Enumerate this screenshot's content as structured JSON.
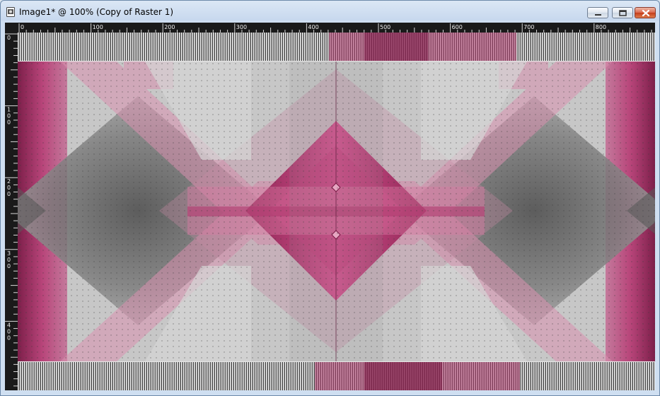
{
  "window": {
    "title": "Image1* @ 100% (Copy of Raster 1)",
    "icon": "image-document-icon",
    "controls": {
      "minimize": "minimize-icon",
      "maximize": "maximize-icon",
      "close": "close-icon"
    }
  },
  "ruler_h": {
    "labels": [
      "0",
      "100",
      "200",
      "300",
      "400",
      "500",
      "600",
      "700",
      "800"
    ]
  },
  "ruler_v": {
    "labels": [
      "0",
      "100",
      "200",
      "300",
      "400"
    ]
  },
  "colors": {
    "magenta": "#b0306a",
    "pink": "#d88aa8",
    "gray_light": "#c6c6c6",
    "gray_dark": "#555555",
    "ruler": "#1a1a1a"
  }
}
